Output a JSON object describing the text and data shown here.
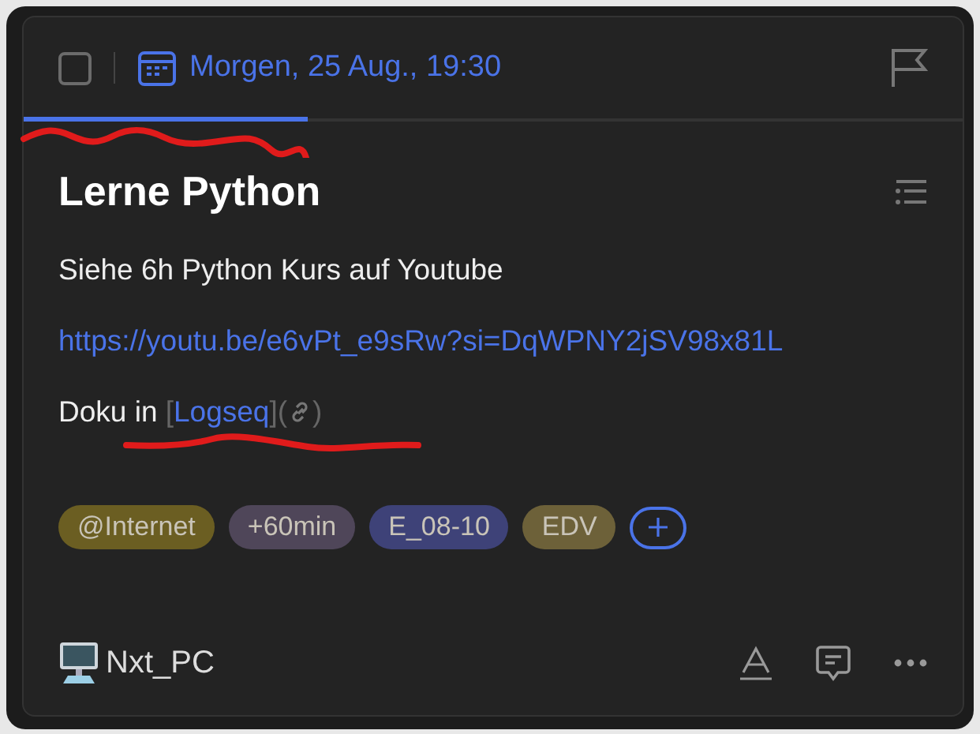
{
  "header": {
    "checked": false,
    "due": "Morgen, 25 Aug., 19:30",
    "flagged": false
  },
  "title": "Lerne Python",
  "lines": [
    {
      "kind": "text",
      "text": "Siehe 6h Python Kurs auf Youtube"
    },
    {
      "kind": "url",
      "text": "https://youtu.be/e6vPt_e9sRw?si=DqWPNY2jSV98x81L"
    },
    {
      "kind": "doc",
      "prefix": "Doku in",
      "open": "[",
      "link": "Logseq",
      "mid": "](",
      "close": ")"
    }
  ],
  "tags": [
    {
      "label": "@Internet",
      "color": "#6b5e22"
    },
    {
      "label": "+60min",
      "color": "#4f4659"
    },
    {
      "label": "E_08-10",
      "color": "#3e4278"
    },
    {
      "label": "EDV",
      "color": "#6d6139"
    }
  ],
  "footer": {
    "project": "Nxt_PC"
  }
}
